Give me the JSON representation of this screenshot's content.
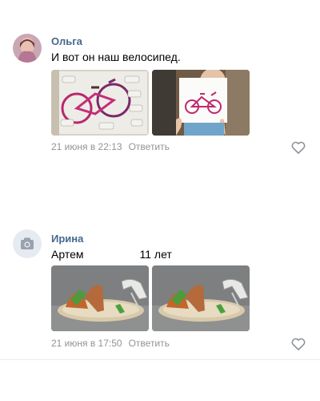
{
  "comments": [
    {
      "author": "Ольга",
      "text": "И вот он наш велосипед.",
      "date": "21 июня в 22:13",
      "reply_label": "Ответить",
      "photos": [
        "bicycle-worksheet-photo",
        "bicycle-drawing-photo"
      ]
    },
    {
      "author": "Ирина",
      "text": "Артем                  11 лет",
      "date": "21 июня в 17:50",
      "reply_label": "Ответить",
      "photos": [
        "sandal-craft-photo",
        "sandal-craft-photo"
      ]
    }
  ],
  "colors": {
    "author": "#45688e",
    "meta": "#939393",
    "divider": "#ecedee"
  },
  "icons": {
    "like": "heart-outline-icon",
    "camera": "camera-icon"
  }
}
